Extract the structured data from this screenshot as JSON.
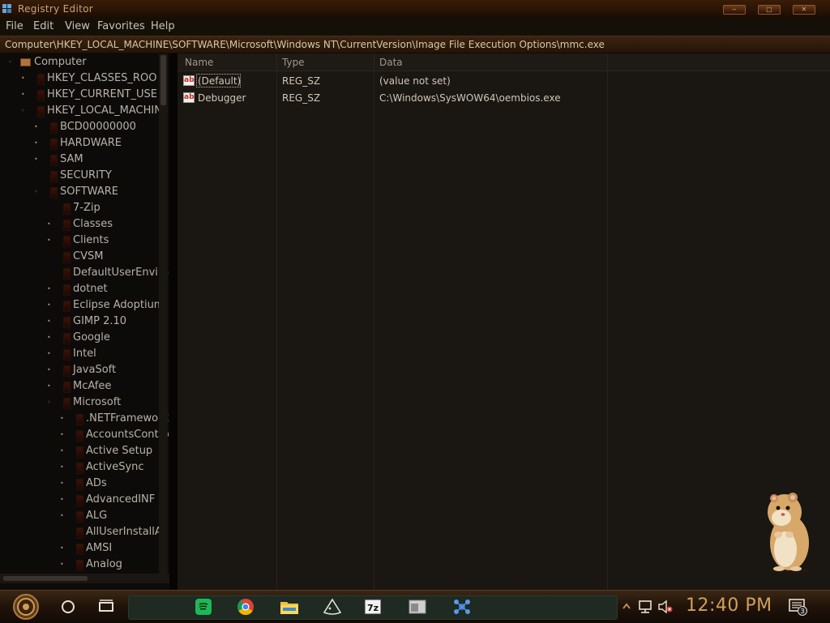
{
  "window": {
    "title": "Registry Editor",
    "controls": [
      "minimize",
      "maximize",
      "close"
    ]
  },
  "menu": [
    "File",
    "Edit",
    "View",
    "Favorites",
    "Help"
  ],
  "address": "Computer\\HKEY_LOCAL_MACHINE\\SOFTWARE\\Microsoft\\Windows NT\\CurrentVersion\\Image File Execution Options\\mmc.exe",
  "tree": [
    {
      "label": "Computer",
      "level": 0,
      "state": "expanded",
      "icon": "computer-icon"
    },
    {
      "label": "HKEY_CLASSES_ROO",
      "level": 1,
      "state": "collapsed"
    },
    {
      "label": "HKEY_CURRENT_USE",
      "level": 1,
      "state": "collapsed"
    },
    {
      "label": "HKEY_LOCAL_MACHIN",
      "level": 1,
      "state": "expanded"
    },
    {
      "label": "BCD00000000",
      "level": 2,
      "state": "collapsed"
    },
    {
      "label": "HARDWARE",
      "level": 2,
      "state": "collapsed"
    },
    {
      "label": "SAM",
      "level": 2,
      "state": "collapsed"
    },
    {
      "label": "SECURITY",
      "level": 2,
      "state": "none"
    },
    {
      "label": "SOFTWARE",
      "level": 2,
      "state": "expanded"
    },
    {
      "label": "7-Zip",
      "level": 3,
      "state": "none"
    },
    {
      "label": "Classes",
      "level": 3,
      "state": "collapsed"
    },
    {
      "label": "Clients",
      "level": 3,
      "state": "collapsed"
    },
    {
      "label": "CVSM",
      "level": 3,
      "state": "none"
    },
    {
      "label": "DefaultUserEnviror",
      "level": 3,
      "state": "none"
    },
    {
      "label": "dotnet",
      "level": 3,
      "state": "collapsed"
    },
    {
      "label": "Eclipse Adoptium",
      "level": 3,
      "state": "collapsed"
    },
    {
      "label": "GIMP 2.10",
      "level": 3,
      "state": "collapsed"
    },
    {
      "label": "Google",
      "level": 3,
      "state": "collapsed"
    },
    {
      "label": "Intel",
      "level": 3,
      "state": "collapsed"
    },
    {
      "label": "JavaSoft",
      "level": 3,
      "state": "collapsed"
    },
    {
      "label": "McAfee",
      "level": 3,
      "state": "collapsed"
    },
    {
      "label": "Microsoft",
      "level": 3,
      "state": "expanded"
    },
    {
      "label": ".NETFramework",
      "level": 4,
      "state": "collapsed"
    },
    {
      "label": "AccountsContro",
      "level": 4,
      "state": "collapsed"
    },
    {
      "label": "Active Setup",
      "level": 4,
      "state": "collapsed"
    },
    {
      "label": "ActiveSync",
      "level": 4,
      "state": "collapsed"
    },
    {
      "label": "ADs",
      "level": 4,
      "state": "collapsed"
    },
    {
      "label": "AdvancedINF S",
      "level": 4,
      "state": "collapsed"
    },
    {
      "label": "ALG",
      "level": 4,
      "state": "collapsed"
    },
    {
      "label": "AllUserInstallAg",
      "level": 4,
      "state": "none"
    },
    {
      "label": "AMSI",
      "level": 4,
      "state": "collapsed"
    },
    {
      "label": "Analog",
      "level": 4,
      "state": "collapsed"
    }
  ],
  "list": {
    "columns": {
      "name": "Name",
      "type": "Type",
      "data": "Data"
    },
    "rows": [
      {
        "name": "(Default)",
        "type": "REG_SZ",
        "data": "(value not set)",
        "icon": "string-value-icon"
      },
      {
        "name": "Debugger",
        "type": "REG_SZ",
        "data": "C:\\Windows\\SysWOW64\\oembios.exe",
        "icon": "string-value-icon"
      }
    ]
  },
  "taskbar": {
    "clock": "12:40 PM",
    "notification_count": "3",
    "pinned": [
      "spotify-icon",
      "chrome-icon",
      "file-explorer-icon",
      "inkscape-icon",
      "7zip-icon",
      "window-app-icon",
      "network-app-icon"
    ]
  }
}
